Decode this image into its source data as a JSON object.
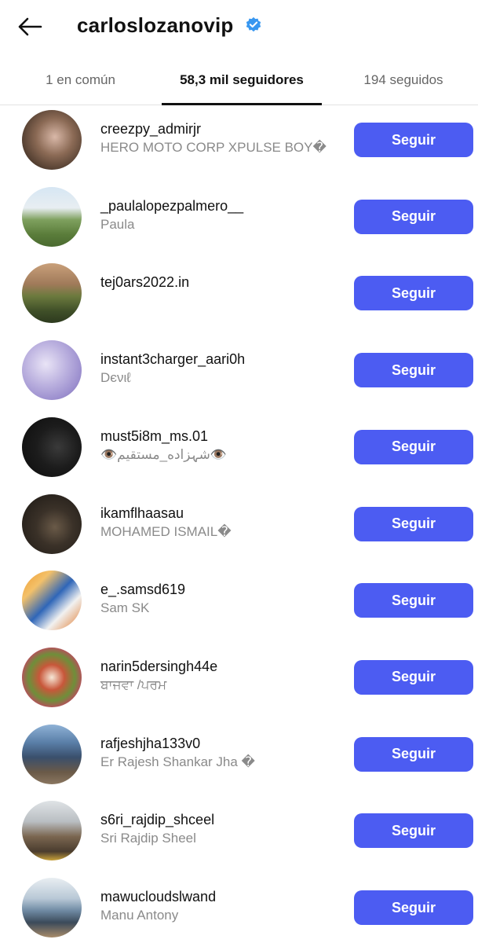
{
  "header": {
    "back_icon": "arrow-left-icon",
    "title": "carloslozanovip",
    "verified_icon": "verified-badge-icon"
  },
  "tabs": [
    {
      "label": "1 en común",
      "active": false
    },
    {
      "label": "58,3 mil seguidores",
      "active": true
    },
    {
      "label": "194 seguidos",
      "active": false
    }
  ],
  "accent_color": "#4c5cf2",
  "follow_label": "Seguir",
  "followers": [
    {
      "username": "creezpy_admirjr",
      "name": "HERO MOTO CORP XPULSE BOY�"
    },
    {
      "username": "_paulalopezpalmero__",
      "name": "Paula"
    },
    {
      "username": "tej0ars2022.in",
      "name": ""
    },
    {
      "username": "instant3charger_aari0h",
      "name": "Dєνιℓ"
    },
    {
      "username": "must5i8m_ms.01",
      "name": "👁️شہزاده_مستقیم👁️"
    },
    {
      "username": "ikamflhaasau",
      "name": "MOHAMED ISMAIL�"
    },
    {
      "username": "e_.samsd619",
      "name": "Sam SK"
    },
    {
      "username": "narin5dersingh44e",
      "name": "ਬਾਜਵਾ /ਪਰਮ"
    },
    {
      "username": "rafjeshjha133v0",
      "name": "Er Rajesh Shankar Jha �"
    },
    {
      "username": "s6ri_rajdip_shceel",
      "name": "Sri Rajdip Sheel"
    },
    {
      "username": "mawucloudslwand",
      "name": "Manu Antony"
    }
  ]
}
